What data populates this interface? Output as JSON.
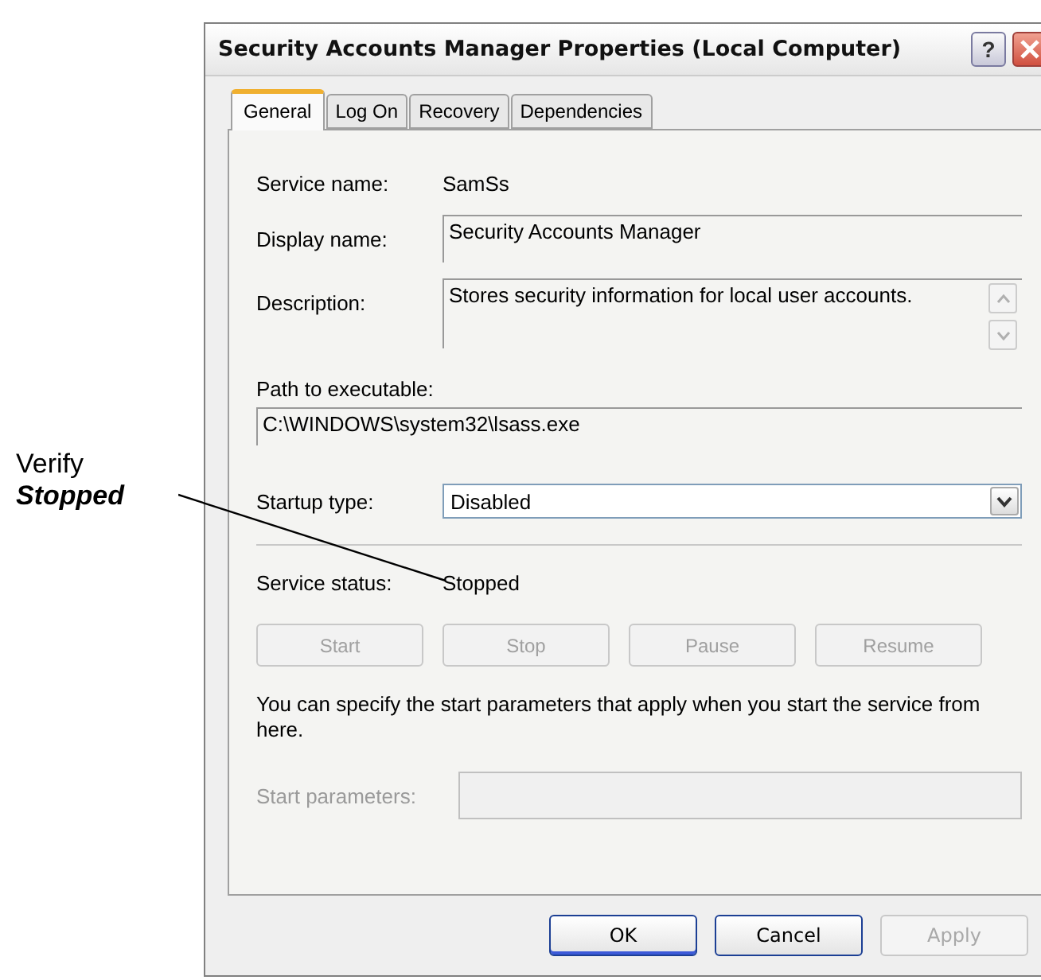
{
  "annotation": [
    {
      "text": "Verify",
      "kind": "plain"
    },
    {
      "text": "Stopped",
      "kind": "emphasis"
    }
  ],
  "window": {
    "title": "Security Accounts Manager Properties (Local Computer)",
    "help_button": "?"
  },
  "tabs": [
    {
      "label": "General",
      "selected": true
    },
    {
      "label": "Log On",
      "selected": false
    },
    {
      "label": "Recovery",
      "selected": false
    },
    {
      "label": "Dependencies",
      "selected": false
    }
  ],
  "service_name": {
    "label": "Service name:",
    "value": "SamSs"
  },
  "display_name": {
    "label": "Display name:",
    "value": "Security Accounts Manager"
  },
  "description": {
    "label": "Description:",
    "value": "Stores security information for local user accounts."
  },
  "path": {
    "label": "Path to executable:",
    "value": "C:\\WINDOWS\\system32\\lsass.exe"
  },
  "startup_type": {
    "label": "Startup type:",
    "value": "Disabled"
  },
  "service_status": {
    "label": "Service status:",
    "value": "Stopped"
  },
  "service_buttons": [
    {
      "label": "Start",
      "disabled": true
    },
    {
      "label": "Stop",
      "disabled": true
    },
    {
      "label": "Pause",
      "disabled": true
    },
    {
      "label": "Resume",
      "disabled": true
    }
  ],
  "hint": "You can specify the start parameters that apply when you start the service from here.",
  "start_parameters": {
    "label": "Start parameters:",
    "disabled": true
  },
  "dialog_buttons": [
    {
      "label": "OK",
      "disabled": false,
      "default": true
    },
    {
      "label": "Cancel",
      "disabled": false,
      "default": false
    },
    {
      "label": "Apply",
      "disabled": true,
      "default": false
    }
  ]
}
